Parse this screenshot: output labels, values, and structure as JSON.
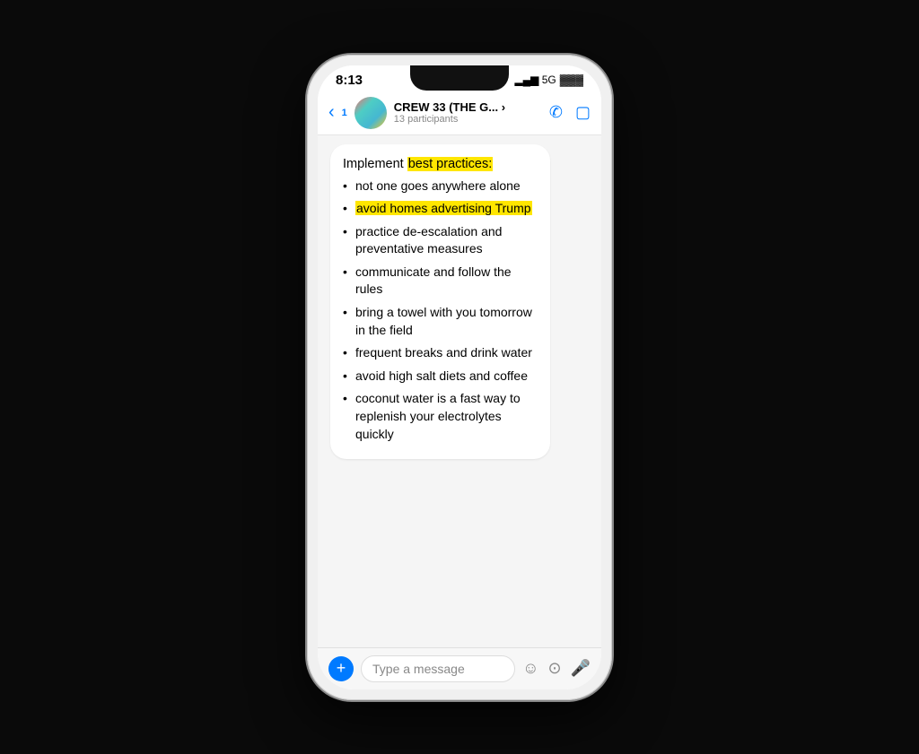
{
  "status": {
    "time": "8:13",
    "signal": "5G",
    "battery": "▮"
  },
  "header": {
    "back_label": "‹",
    "badge": "1",
    "group_name": "CREW 33 (THE G... ›",
    "participants": "13 participants"
  },
  "message": {
    "intro": "Implement ",
    "intro_highlight": "best practices:",
    "bullets": [
      {
        "text": "not one goes anywhere alone",
        "highlight": false
      },
      {
        "text": "avoid homes advertising Trump",
        "highlight": true
      },
      {
        "text": "practice de-escalation and preventative measures",
        "highlight": false
      },
      {
        "text": "communicate and follow the rules",
        "highlight": false
      },
      {
        "text": "bring a towel with you tomorrow in the field",
        "highlight": false
      },
      {
        "text": "frequent breaks and drink water",
        "highlight": false
      },
      {
        "text": "avoid high salt diets and coffee",
        "highlight": false
      },
      {
        "text": "coconut water is a fast way to replenish your electrolytes quickly",
        "highlight": false
      }
    ]
  },
  "input": {
    "placeholder": "Type a message"
  },
  "icons": {
    "back": "‹",
    "add": "+",
    "phone": "📞",
    "video": "📹",
    "emoji": "☺",
    "camera": "⊙",
    "mic": "🎤"
  }
}
